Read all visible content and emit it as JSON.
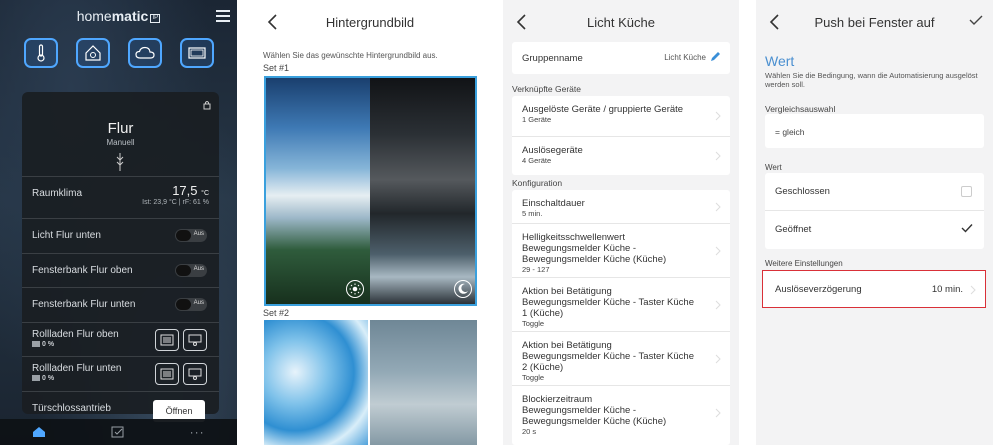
{
  "dashboard": {
    "logo_text": "home",
    "logo_bold": "matic",
    "logo_badge": "IP",
    "room_name": "Flur",
    "room_mode": "Manuell",
    "climate": {
      "label": "Raumklima",
      "temp": "17,5",
      "unit": "°C",
      "details": "Ist: 23,9 °C | rF: 61 %"
    },
    "devices": [
      {
        "label": "Licht Flur unten",
        "state": "Aus"
      },
      {
        "label": "Fensterbank Flur oben",
        "state": "Aus"
      },
      {
        "label": "Fensterbank Flur unten",
        "state": "Aus"
      }
    ],
    "shutters": [
      {
        "label": "Rollladen Flur oben",
        "level": "0 %"
      },
      {
        "label": "Rollladen Flur unten",
        "level": "0 %"
      }
    ],
    "door": {
      "label": "Türschlossantrieb",
      "action": "Öffnen"
    },
    "tabbar_more": "···"
  },
  "wallpaper": {
    "title": "Hintergrundbild",
    "hint": "Wählen Sie das gewünschte Hintergrundbild aus.",
    "set1_label": "Set #1",
    "set2_label": "Set #2"
  },
  "group": {
    "title": "Licht Küche",
    "name_label": "Gruppenname",
    "name_value": "Licht Küche",
    "sec_devices": "Verknüpfte Geräte",
    "linked": [
      {
        "title": "Ausgelöste Geräte / gruppierte Geräte",
        "sub": "1 Geräte"
      },
      {
        "title": "Auslösegeräte",
        "sub": "4 Geräte"
      }
    ],
    "sec_config": "Konfiguration",
    "config": [
      {
        "title": "Einschaltdauer",
        "sub": "5 min."
      },
      {
        "title": "Helligkeitsschwellenwert\nBewegungsmelder Küche -\nBewegungsmelder Küche (Küche)",
        "sub": "29 - 127"
      },
      {
        "title": "Aktion bei Betätigung\nBewegungsmelder Küche - Taster Küche\n1 (Küche)",
        "sub": "Toggle"
      },
      {
        "title": "Aktion bei Betätigung\nBewegungsmelder Küche - Taster Küche\n2 (Küche)",
        "sub": "Toggle"
      },
      {
        "title": "Blockierzeitraum\nBewegungsmelder Küche -\nBewegungsmelder Küche (Küche)",
        "sub": "20 s"
      }
    ]
  },
  "automation": {
    "title": "Push bei Fenster auf",
    "heading": "Wert",
    "description": "Wählen Sie die Bedingung, wann die Automatisierung ausgelöst werden soll.",
    "compare_label": "Vergleichsauswahl",
    "compare_value": "= gleich",
    "value_label": "Wert",
    "options": [
      {
        "label": "Geschlossen",
        "checked": false
      },
      {
        "label": "Geöffnet",
        "checked": true
      }
    ],
    "more_label": "Weitere Einstellungen",
    "delay_label": "Auslöseverzögerung",
    "delay_value": "10 min."
  },
  "colors": {
    "accent_blue": "#4fa7ff",
    "highlight_red": "#d93038",
    "heading_blue": "#4a8fd0"
  }
}
